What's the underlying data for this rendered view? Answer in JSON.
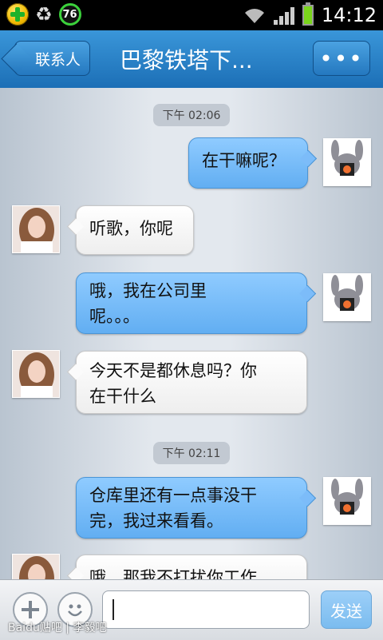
{
  "status_bar": {
    "battery_ring_value": "76",
    "time": "14:12"
  },
  "header": {
    "back_label": "联系人",
    "title": "巴黎铁塔下...",
    "more_label": "•••"
  },
  "timestamps": [
    "下午 02:06",
    "下午 02:11"
  ],
  "messages": [
    {
      "side": "out",
      "text": "在干嘛呢？"
    },
    {
      "side": "in",
      "text": "听歌，你呢"
    },
    {
      "side": "out",
      "text": "哦，我在公司里\n呢。。。"
    },
    {
      "side": "in",
      "text": "今天不是都休息吗？你\n在干什么"
    },
    {
      "side": "out",
      "text": "仓库里还有一点事没干\n完，我过来看看。"
    },
    {
      "side": "in",
      "text": "哦，那我不打扰你工作"
    }
  ],
  "input_bar": {
    "placeholder": "",
    "send_label": "发送"
  },
  "watermark": "Baidu贴吧 | 李毅吧",
  "colors": {
    "title_bar": "#2b85ca",
    "outgoing_bubble": "#7cbcf9",
    "incoming_bubble": "#ffffff"
  }
}
